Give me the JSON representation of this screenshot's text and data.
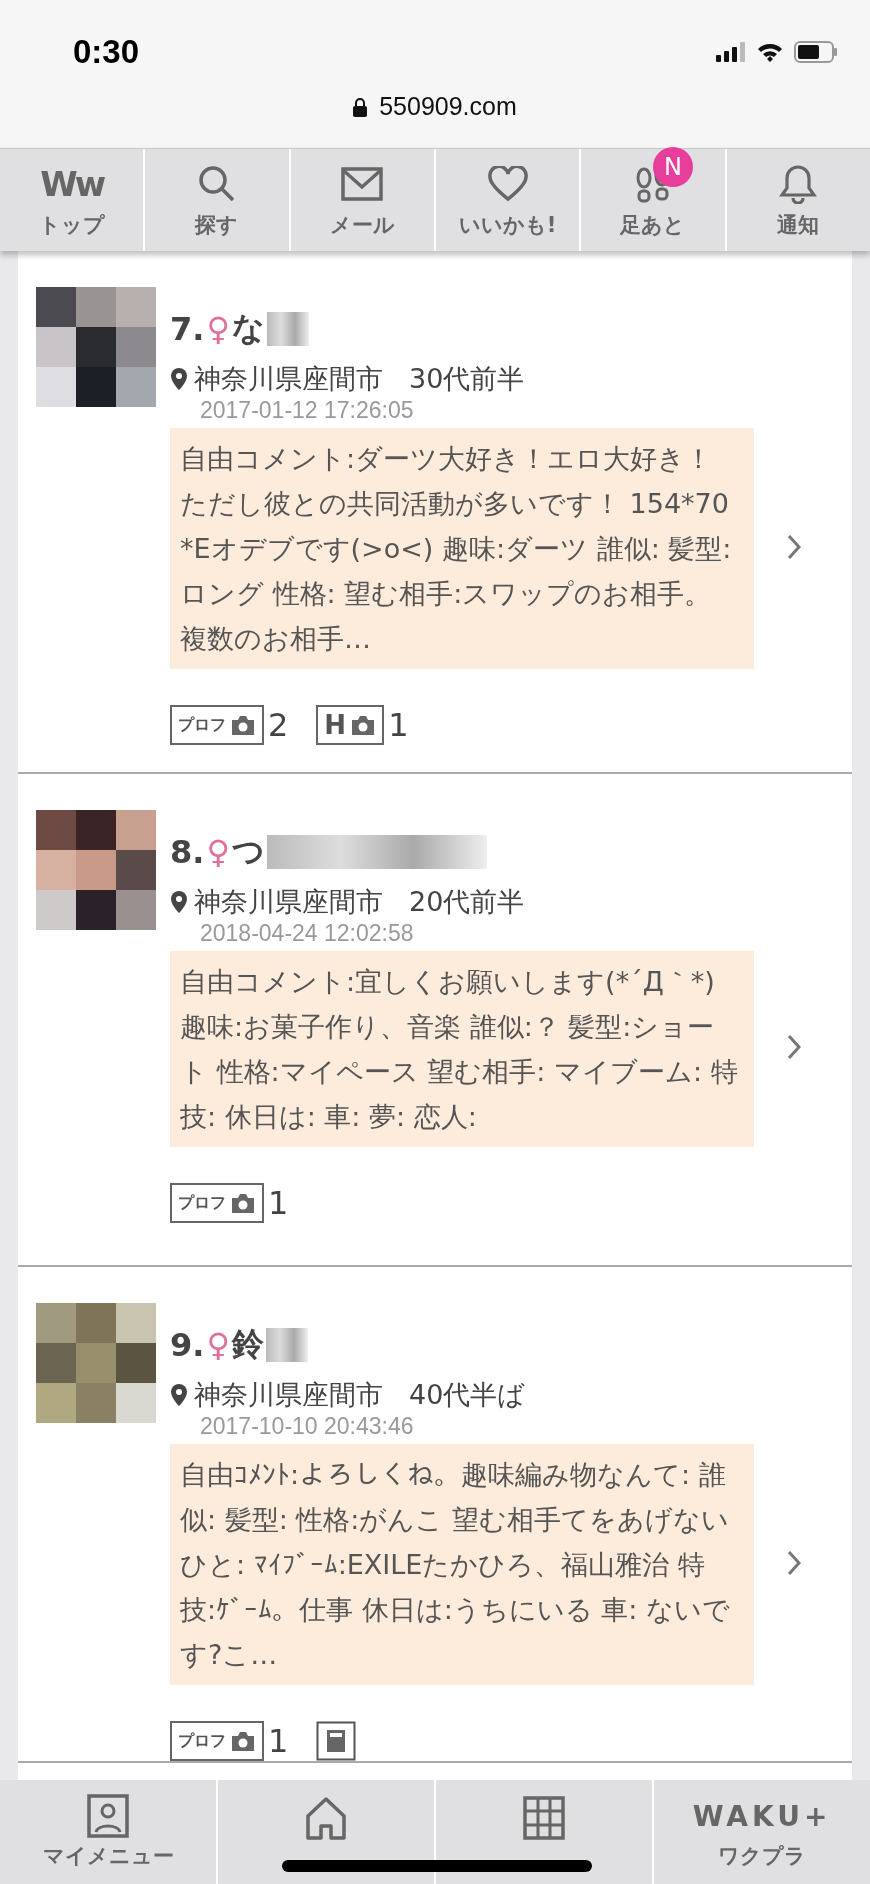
{
  "status_bar": {
    "time": "0:30",
    "url": "550909.com"
  },
  "top_nav": [
    {
      "kind": "logo",
      "logo_text": "Ww",
      "label": "トップ"
    },
    {
      "kind": "search",
      "label": "探す"
    },
    {
      "kind": "mail",
      "label": "メール"
    },
    {
      "kind": "heart",
      "label": "いいかも!"
    },
    {
      "kind": "footprints",
      "label": "足あと",
      "badge": "N"
    },
    {
      "kind": "bell",
      "label": "通知"
    }
  ],
  "results": [
    {
      "number": "7.",
      "gender": "♀",
      "name": "な",
      "location": "神奈川県座間市",
      "age": "30代前半",
      "date": "2017-01-12 17:26:05",
      "comment": "自由コメント:ダーツ大好き！エロ大好き！ただし彼との共同活動が多いです！ 154*70*Eオデブです(>o<) 趣味:ダーツ 誰似: 髪型:ロング 性格: 望む相手:スワップのお相手。複数のお相手…",
      "tags": [
        {
          "kind": "prof",
          "label": "プロフ",
          "count": "2"
        },
        {
          "kind": "h",
          "label": "H",
          "count": "1"
        }
      ]
    },
    {
      "number": "8.",
      "gender": "♀",
      "name": "つ",
      "location": "神奈川県座間市",
      "age": "20代前半",
      "date": "2018-04-24 12:02:58",
      "comment": "自由コメント:宜しくお願いします(*´Д｀*) 趣味:お菓子作り、音楽 誰似:？ 髪型:ショート 性格:マイペース 望む相手: マイブーム: 特技: 休日は: 車: 夢: 恋人:",
      "tags": [
        {
          "kind": "prof",
          "label": "プロフ",
          "count": "1"
        }
      ]
    },
    {
      "number": "9.",
      "gender": "♀",
      "name": "鈴",
      "location": "神奈川県座間市",
      "age": "40代半ば",
      "date": "2017-10-10 20:43:46",
      "comment": "自由ｺﾒﾝﾄ:よろしくね。趣味編み物なんて: 誰似: 髪型: 性格:がんこ 望む相手てをあげないひと: ﾏｲﾌﾞｰﾑ:EXILEたかひろ、福山雅治 特技:ｹﾞｰﾑ。仕事 休日は:うちにいる 車: ないです?こ…",
      "tags": [
        {
          "kind": "prof",
          "label": "プロフ",
          "count": "1"
        },
        {
          "kind": "memo"
        }
      ]
    }
  ],
  "bottom_nav": [
    {
      "kind": "person",
      "label": "マイメニュー"
    },
    {
      "kind": "home"
    },
    {
      "kind": "grid"
    },
    {
      "kind": "logo",
      "logo_text": "WAKU+",
      "label": "ワクプラ"
    }
  ]
}
